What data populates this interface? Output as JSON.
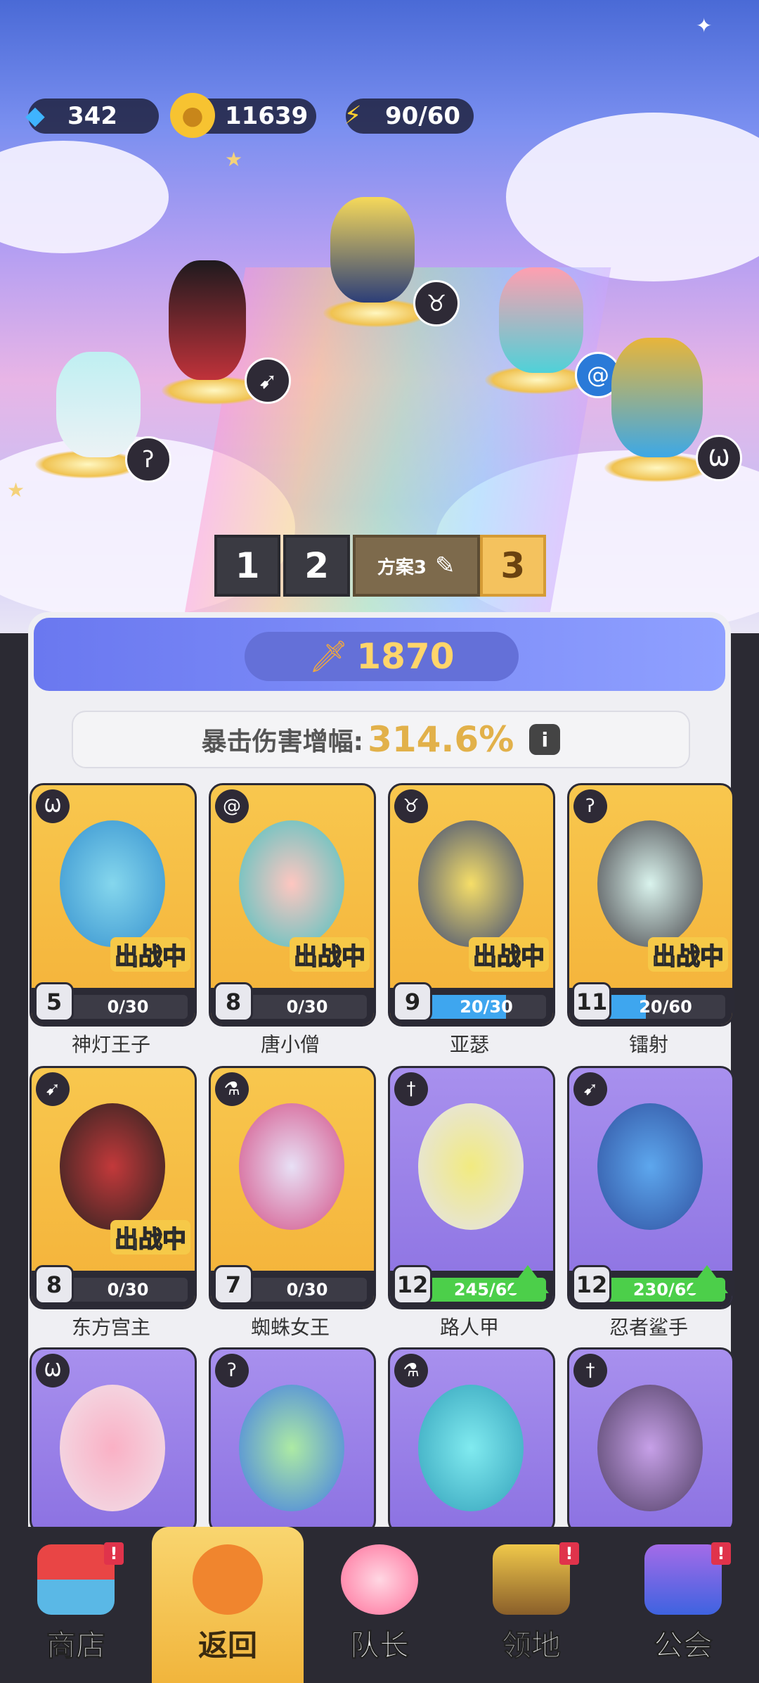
{
  "resources": {
    "gems": "342",
    "coins": "11639",
    "energy": "90/60"
  },
  "plans": {
    "tab1": "1",
    "tab2": "2",
    "current_label": "方案3",
    "tab3": "3"
  },
  "power": "1870",
  "crit": {
    "label": "暴击伤害增幅:",
    "value": "314.6%",
    "info_icon": "i"
  },
  "cards": [
    {
      "name": "神灯王子",
      "level": "5",
      "progress": "0/30",
      "fill": 0,
      "tier": "gold",
      "deployed": true,
      "role_icon": "wings-icon"
    },
    {
      "name": "唐小僧",
      "level": "8",
      "progress": "0/30",
      "fill": 0,
      "tier": "gold",
      "deployed": true,
      "role_icon": "spiral-icon"
    },
    {
      "name": "亚瑟",
      "level": "9",
      "progress": "20/30",
      "fill": 0.667,
      "tier": "gold",
      "deployed": true,
      "role_icon": "bull-icon"
    },
    {
      "name": "镭射",
      "level": "11",
      "progress": "20/60",
      "fill": 0.333,
      "tier": "gold",
      "deployed": true,
      "role_icon": "magic-icon"
    },
    {
      "name": "东方宫主",
      "level": "8",
      "progress": "0/30",
      "fill": 0,
      "tier": "gold",
      "deployed": true,
      "role_icon": "bow-icon"
    },
    {
      "name": "蜘蛛女王",
      "level": "7",
      "progress": "0/30",
      "fill": 0,
      "tier": "gold",
      "deployed": false,
      "role_icon": "potion-icon"
    },
    {
      "name": "路人甲",
      "level": "12",
      "progress": "245/60",
      "fill": 1,
      "tier": "purple",
      "deployed": false,
      "upgrade": true,
      "role_icon": "sword-icon"
    },
    {
      "name": "忍者鲨手",
      "level": "12",
      "progress": "230/60",
      "fill": 1,
      "tier": "purple",
      "deployed": false,
      "upgrade": true,
      "role_icon": "bow-icon"
    }
  ],
  "deploy_label": "出战中",
  "nav": [
    {
      "label": "商店",
      "badge": "!"
    },
    {
      "label": "返回",
      "badge": ""
    },
    {
      "label": "队长",
      "badge": ""
    },
    {
      "label": "领地",
      "badge": "!"
    },
    {
      "label": "公会",
      "badge": "!"
    }
  ]
}
